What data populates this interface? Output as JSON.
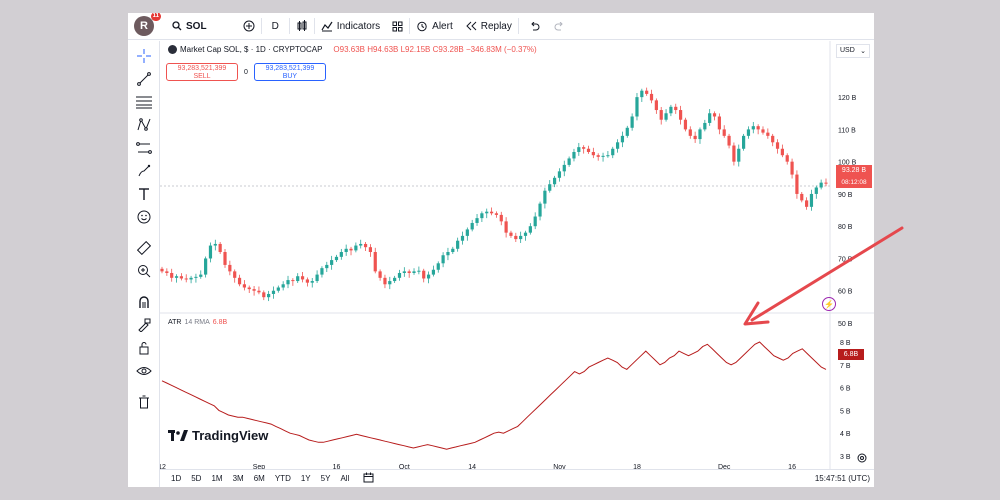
{
  "topbar": {
    "avatar_letter": "R",
    "notif_count": "11",
    "symbol": "SOL",
    "interval": "D",
    "indicators_label": "Indicators",
    "alert_label": "Alert",
    "replay_label": "Replay"
  },
  "legend": {
    "title": "Market Cap SOL, $ · 1D · CRYPTOCAP",
    "ohlc": "O93.63B H94.63B L92.15B C93.28B −346.83M (−0.37%)"
  },
  "trade": {
    "sell_value": "93,283,521,399",
    "sell_label": "SELL",
    "spread": "0",
    "buy_value": "93,283,521,399",
    "buy_label": "BUY"
  },
  "currency": "USD",
  "price_axis": [
    "120 B",
    "110 B",
    "100 B",
    "90 B",
    "80 B",
    "70 B",
    "60 B",
    "50 B"
  ],
  "atr_axis": [
    "8 B",
    "7 B",
    "6 B",
    "5 B",
    "4 B",
    "3 B"
  ],
  "last_price": "93.28 B",
  "countdown": "08:12:08",
  "atr_legend": {
    "name": "ATR",
    "params": "14 RMA",
    "value": "6.8B"
  },
  "atr_last": "6.8B",
  "logo_text": "TradingView",
  "time_axis": [
    "12",
    "Sep",
    "16",
    "Oct",
    "14",
    "Nov",
    "18",
    "Dec",
    "16"
  ],
  "ranges": [
    "1D",
    "5D",
    "1M",
    "3M",
    "6M",
    "YTD",
    "1Y",
    "5Y",
    "All"
  ],
  "clock": "15:47:51 (UTC)",
  "colors": {
    "up": "#26a69a",
    "down": "#ef5350",
    "atr": "#b71c1c",
    "arrow": "#e5484d",
    "background": "#d2cfd3"
  },
  "chart_data": {
    "type": "candlestick",
    "price_ylim": [
      50,
      125
    ],
    "atr_ylim": [
      3,
      8
    ],
    "closes": [
      66,
      65.5,
      64,
      64.5,
      63.8,
      63.5,
      64,
      64.3,
      65,
      70,
      74,
      74.5,
      72,
      68,
      66,
      64,
      62,
      61,
      60.5,
      60,
      59.5,
      58,
      59,
      60,
      61,
      62,
      63.3,
      63,
      64.5,
      63.5,
      62.5,
      63,
      65,
      67,
      68,
      69.5,
      70.5,
      72,
      73,
      72.5,
      74,
      74.5,
      73.5,
      72,
      66,
      64,
      62,
      63,
      64,
      65.5,
      66,
      65.5,
      66,
      66.2,
      63.8,
      65,
      66.5,
      68.5,
      71,
      72,
      73,
      75.5,
      77,
      79,
      81,
      82.5,
      84,
      84.5,
      84,
      83.5,
      81.5,
      78,
      77,
      76,
      77,
      78,
      80,
      83,
      87,
      91,
      93,
      95,
      97,
      99,
      101,
      103,
      104.5,
      104,
      103,
      102,
      101.5,
      101.8,
      102,
      104,
      106,
      108,
      110.5,
      114,
      120,
      122,
      121,
      119,
      116,
      113,
      115,
      117,
      116,
      113,
      110,
      108,
      107,
      110,
      112,
      115,
      114,
      110,
      108,
      105,
      100,
      104,
      108,
      110,
      111,
      110,
      109,
      108,
      106,
      104,
      102,
      100,
      96,
      90,
      88,
      86,
      90,
      92,
      93.5,
      93.28
    ],
    "atr": [
      6.3,
      6.2,
      6.1,
      6.0,
      5.9,
      5.8,
      5.7,
      5.6,
      5.5,
      5.4,
      5.3,
      5.2,
      5.0,
      4.9,
      4.8,
      4.75,
      4.7,
      4.7,
      4.65,
      4.6,
      4.55,
      4.5,
      4.45,
      4.4,
      4.3,
      4.2,
      4.1,
      4.0,
      3.95,
      3.9,
      3.8,
      3.7,
      3.65,
      3.6,
      3.6,
      3.65,
      3.7,
      3.75,
      3.8,
      3.85,
      3.9,
      3.95,
      3.9,
      3.85,
      3.8,
      3.75,
      3.7,
      3.65,
      3.6,
      3.55,
      3.5,
      3.45,
      3.4,
      3.35,
      3.4,
      3.45,
      3.5,
      3.45,
      3.4,
      3.35,
      3.3,
      3.35,
      3.4,
      3.45,
      3.5,
      3.55,
      3.6,
      3.7,
      3.8,
      3.9,
      4.0,
      4.05,
      4.0,
      4.1,
      4.2,
      4.3,
      4.5,
      4.7,
      4.9,
      5.1,
      5.3,
      5.5,
      5.7,
      5.9,
      6.1,
      6.3,
      6.5,
      6.7,
      6.6,
      6.7,
      6.9,
      7.0,
      7.1,
      7.2,
      7.3,
      7.2,
      7.1,
      6.9,
      6.8,
      7.0,
      7.2,
      7.4,
      7.6,
      7.4,
      7.2,
      7.0,
      7.1,
      7.3,
      7.4,
      7.6,
      7.5,
      7.4,
      7.5,
      7.6,
      7.8,
      7.9,
      7.7,
      7.5,
      7.3,
      7.1,
      7.0,
      7.1,
      7.3,
      7.5,
      7.7,
      7.9,
      8.0,
      7.8,
      7.6,
      7.4,
      7.3,
      7.2,
      7.3,
      7.5,
      7.6,
      7.7,
      7.5,
      7.3,
      7.1,
      6.9,
      6.8
    ]
  }
}
